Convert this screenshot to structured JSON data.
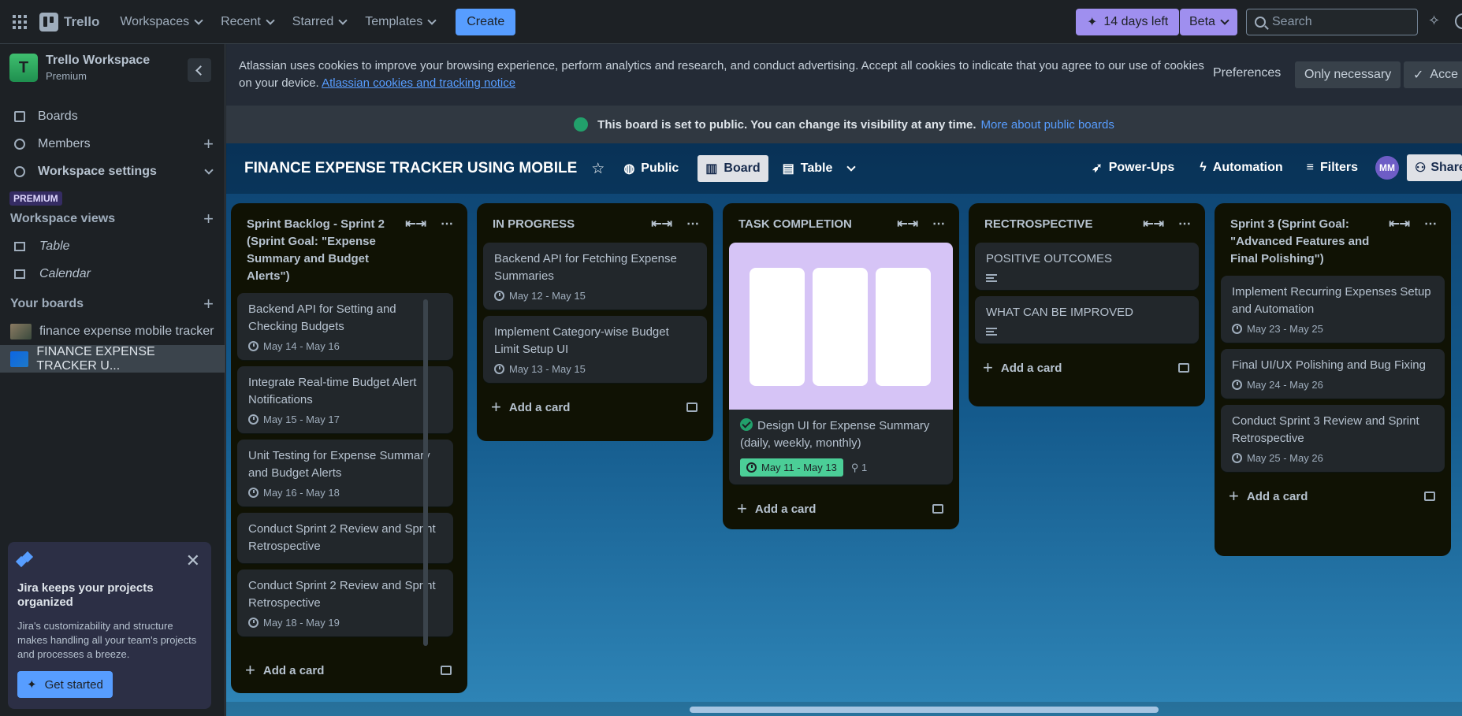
{
  "topbar": {
    "app_name": "Trello",
    "nav": [
      "Workspaces",
      "Recent",
      "Starred",
      "Templates"
    ],
    "create_label": "Create",
    "trial_label": "14 days left",
    "beta_label": "Beta",
    "search_placeholder": "Search"
  },
  "sidebar": {
    "workspace_initial": "T",
    "workspace_name": "Trello Workspace",
    "workspace_plan": "Premium",
    "items": [
      {
        "label": "Boards"
      },
      {
        "label": "Members"
      },
      {
        "label": "Workspace settings"
      }
    ],
    "premium_badge": "PREMIUM",
    "views_header": "Workspace views",
    "views": [
      {
        "label": "Table"
      },
      {
        "label": "Calendar"
      }
    ],
    "boards_header": "Your boards",
    "boards": [
      {
        "label": "finance expense mobile tracker"
      },
      {
        "label": "FINANCE EXPENSE TRACKER U..."
      }
    ],
    "jira": {
      "title": "Jira keeps your projects organized",
      "body": "Jira's customizability and structure makes handling all your team's projects and processes a breeze.",
      "button": "Get started"
    }
  },
  "cookie": {
    "text": "Atlassian uses cookies to improve your browsing experience, perform analytics and research, and conduct advertising. Accept all cookies to indicate that you agree to our use of cookies on your device.",
    "link": "Atlassian cookies and tracking notice",
    "preferences": "Preferences",
    "only_necessary": "Only necessary",
    "accept": "Acce"
  },
  "public_notice": {
    "text": "This board is set to public. You can change its visibility at any time.",
    "link": "More about public boards"
  },
  "board": {
    "title": "FINANCE EXPENSE TRACKER USING MOBILE",
    "visibility": "Public",
    "view_board": "Board",
    "view_table": "Table",
    "powerups": "Power-Ups",
    "automation": "Automation",
    "filters": "Filters",
    "avatar": "MM",
    "share": "Share"
  },
  "lists": [
    {
      "title": "Sprint Backlog - Sprint 2 (Sprint Goal: \"Expense Summary and Budget Alerts\")",
      "cards": [
        {
          "title": "Backend API for Setting and Checking Budgets",
          "date": "May 14 - May 16"
        },
        {
          "title": "Integrate Real-time Budget Alert Notifications",
          "date": "May 15 - May 17"
        },
        {
          "title": "Unit Testing for Expense Summary and Budget Alerts",
          "date": "May 16 - May 18"
        },
        {
          "title": "Conduct Sprint 2 Review and Sprint Retrospective",
          "date": ""
        },
        {
          "title": "Conduct Sprint 2 Review and Sprint Retrospective",
          "date": "May 18 - May 19"
        }
      ]
    },
    {
      "title": "IN PROGRESS",
      "cards": [
        {
          "title": "Backend API for Fetching Expense Summaries",
          "date": "May 12 - May 15"
        },
        {
          "title": "Implement Category-wise Budget Limit Setup UI",
          "date": "May 13 - May 15"
        }
      ]
    },
    {
      "title": "TASK COMPLETION",
      "cards": [
        {
          "title": "Design UI for Expense Summary (daily, weekly, monthly)",
          "date": "May 11 - May 13",
          "attachments": "1"
        }
      ]
    },
    {
      "title": "RECTROSPECTIVE",
      "cards": [
        {
          "title": "POSITIVE OUTCOMES"
        },
        {
          "title": "WHAT CAN BE IMPROVED"
        }
      ]
    },
    {
      "title": "Sprint 3 (Sprint Goal: \"Advanced Features and Final Polishing\")",
      "cards": [
        {
          "title": "Implement Recurring Expenses Setup and Automation",
          "date": "May 23 - May 25"
        },
        {
          "title": "Final UI/UX Polishing and Bug Fixing",
          "date": "May 24 - May 26"
        },
        {
          "title": "Conduct Sprint 3 Review and Sprint Retrospective",
          "date": "May 25 - May 26"
        }
      ]
    }
  ],
  "add_card_label": "Add a card",
  "colors": {
    "accent": "#579dff",
    "trial": "#9f8fef",
    "done": "#4bce97",
    "list_bg": "#101204",
    "card_bg": "#22272b"
  }
}
